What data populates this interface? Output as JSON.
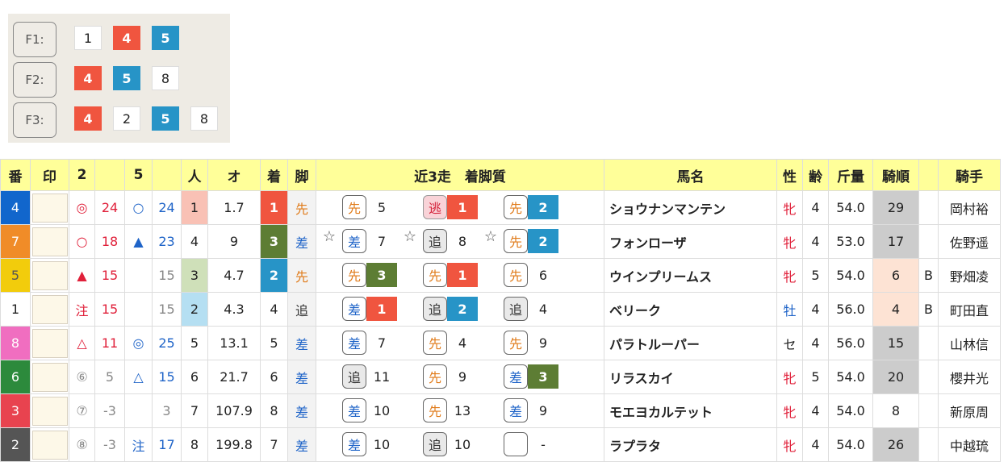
{
  "formation": [
    {
      "label": "F1:",
      "boxes": [
        {
          "v": "1",
          "c": "w"
        },
        {
          "v": "4",
          "c": "r"
        },
        {
          "v": "5",
          "c": "b"
        }
      ]
    },
    {
      "label": "F2:",
      "boxes": [
        {
          "v": "4",
          "c": "r"
        },
        {
          "v": "5",
          "c": "b"
        },
        {
          "v": "8",
          "c": "w"
        }
      ]
    },
    {
      "label": "F3:",
      "boxes": [
        {
          "v": "4",
          "c": "r"
        },
        {
          "v": "2",
          "c": "w"
        },
        {
          "v": "5",
          "c": "b"
        },
        {
          "v": "8",
          "c": "w"
        }
      ]
    }
  ],
  "headers": [
    "番",
    "印",
    "2",
    "",
    "5",
    "",
    "人",
    "オ",
    "着",
    "脚",
    "近3走　着脚質",
    "馬名",
    "性",
    "齢",
    "斤量",
    "騎順",
    "",
    "騎手"
  ],
  "rows": [
    {
      "waku": "4",
      "wakuColor": "#1166cc",
      "m2": "◎",
      "m2c": "red",
      "v2": "24",
      "v2c": "red",
      "m5": "○",
      "m5c": "blue",
      "v5": "24",
      "v5c": "blue",
      "ninki": "1",
      "nk": "1",
      "odds": "1.7",
      "chaku": "1",
      "ck": "1",
      "kyaku": "先",
      "kyc": "orange",
      "runs": [
        {
          "star": "",
          "style": "先",
          "sc": "sen",
          "pos": "5",
          "pc": ""
        },
        {
          "star": "",
          "style": "逃",
          "sc": "nige",
          "pos": "1",
          "pc": "c1"
        },
        {
          "star": "",
          "style": "先",
          "sc": "sen",
          "pos": "2",
          "pc": "c2"
        }
      ],
      "name": "ショウナンマンテン",
      "sex": "牝",
      "sexc": "f",
      "age": "4",
      "kin": "54.0",
      "kij": "29",
      "kijc": "g",
      "b": "",
      "jockey": "岡村裕"
    },
    {
      "waku": "7",
      "wakuColor": "#f08c28",
      "m2": "○",
      "m2c": "red",
      "v2": "18",
      "v2c": "red",
      "m5": "▲",
      "m5c": "blue",
      "v5": "23",
      "v5c": "blue",
      "ninki": "4",
      "nk": "",
      "odds": "9",
      "chaku": "3",
      "ck": "3",
      "kyaku": "差",
      "kyc": "blue",
      "runs": [
        {
          "star": "☆",
          "style": "差",
          "sc": "sa",
          "pos": "7",
          "pc": ""
        },
        {
          "star": "☆",
          "style": "追",
          "sc": "oi",
          "pos": "8",
          "pc": ""
        },
        {
          "star": "☆",
          "style": "先",
          "sc": "sen",
          "pos": "2",
          "pc": "c2"
        }
      ],
      "name": "フォンローザ",
      "sex": "牝",
      "sexc": "f",
      "age": "4",
      "kin": "53.0",
      "kij": "17",
      "kijc": "g",
      "b": "",
      "jockey": "佐野遥"
    },
    {
      "waku": "5",
      "wakuColor": "#f2cc0c",
      "m2": "▲",
      "m2c": "red",
      "v2": "15",
      "v2c": "red",
      "m5": "",
      "m5c": "",
      "v5": "15",
      "v5c": "gray",
      "ninki": "3",
      "nk": "3",
      "odds": "4.7",
      "chaku": "2",
      "ck": "2",
      "kyaku": "先",
      "kyc": "orange",
      "runs": [
        {
          "star": "",
          "style": "先",
          "sc": "sen",
          "pos": "3",
          "pc": "c3"
        },
        {
          "star": "",
          "style": "先",
          "sc": "sen",
          "pos": "1",
          "pc": "c1"
        },
        {
          "star": "",
          "style": "先",
          "sc": "sen",
          "pos": "6",
          "pc": ""
        }
      ],
      "name": "ウインプリームス",
      "sex": "牝",
      "sexc": "f",
      "age": "5",
      "kin": "54.0",
      "kij": "6",
      "kijc": "p",
      "b": "B",
      "jockey": "野畑凌"
    },
    {
      "waku": "1",
      "wakuColor": "#ffffff",
      "m2": "注",
      "m2c": "red",
      "v2": "15",
      "v2c": "red",
      "m5": "",
      "m5c": "",
      "v5": "15",
      "v5c": "gray",
      "ninki": "2",
      "nk": "2",
      "odds": "4.3",
      "chaku": "4",
      "ck": "",
      "kyaku": "追",
      "kyc": "mono",
      "runs": [
        {
          "star": "",
          "style": "差",
          "sc": "sa",
          "pos": "1",
          "pc": "c1"
        },
        {
          "star": "",
          "style": "追",
          "sc": "oi",
          "pos": "2",
          "pc": "c2"
        },
        {
          "star": "",
          "style": "追",
          "sc": "oi",
          "pos": "4",
          "pc": ""
        }
      ],
      "name": "ベリーク",
      "sex": "牡",
      "sexc": "m",
      "age": "4",
      "kin": "56.0",
      "kij": "4",
      "kijc": "p",
      "b": "B",
      "jockey": "町田直"
    },
    {
      "waku": "8",
      "wakuColor": "#f06ec0",
      "m2": "△",
      "m2c": "red",
      "v2": "11",
      "v2c": "red",
      "m5": "◎",
      "m5c": "blue",
      "v5": "25",
      "v5c": "blue",
      "ninki": "5",
      "nk": "",
      "odds": "13.1",
      "chaku": "5",
      "ck": "",
      "kyaku": "差",
      "kyc": "blue",
      "runs": [
        {
          "star": "",
          "style": "差",
          "sc": "sa",
          "pos": "7",
          "pc": ""
        },
        {
          "star": "",
          "style": "先",
          "sc": "sen",
          "pos": "4",
          "pc": ""
        },
        {
          "star": "",
          "style": "先",
          "sc": "sen",
          "pos": "9",
          "pc": ""
        }
      ],
      "name": "パラトルーパー",
      "sex": "セ",
      "sexc": "",
      "age": "4",
      "kin": "56.0",
      "kij": "15",
      "kijc": "g",
      "b": "",
      "jockey": "山林信"
    },
    {
      "waku": "6",
      "wakuColor": "#2c8a3c",
      "m2": "⑥",
      "m2c": "gray",
      "v2": "5",
      "v2c": "gray",
      "m5": "△",
      "m5c": "blue",
      "v5": "15",
      "v5c": "blue",
      "ninki": "6",
      "nk": "",
      "odds": "21.7",
      "chaku": "6",
      "ck": "",
      "kyaku": "差",
      "kyc": "blue",
      "runs": [
        {
          "star": "",
          "style": "追",
          "sc": "oi",
          "pos": "11",
          "pc": ""
        },
        {
          "star": "",
          "style": "先",
          "sc": "sen",
          "pos": "9",
          "pc": ""
        },
        {
          "star": "",
          "style": "差",
          "sc": "sa",
          "pos": "3",
          "pc": "c3"
        }
      ],
      "name": "リラスカイ",
      "sex": "牝",
      "sexc": "f",
      "age": "5",
      "kin": "54.0",
      "kij": "20",
      "kijc": "g",
      "b": "",
      "jockey": "櫻井光"
    },
    {
      "waku": "3",
      "wakuColor": "#e8434f",
      "m2": "⑦",
      "m2c": "gray",
      "v2": "-3",
      "v2c": "gray",
      "m5": "",
      "m5c": "",
      "v5": "3",
      "v5c": "gray",
      "ninki": "7",
      "nk": "",
      "odds": "107.9",
      "chaku": "8",
      "ck": "",
      "kyaku": "差",
      "kyc": "blue",
      "runs": [
        {
          "star": "",
          "style": "差",
          "sc": "sa",
          "pos": "10",
          "pc": ""
        },
        {
          "star": "",
          "style": "先",
          "sc": "sen",
          "pos": "13",
          "pc": ""
        },
        {
          "star": "",
          "style": "差",
          "sc": "sa",
          "pos": "9",
          "pc": ""
        }
      ],
      "name": "モエヨカルテット",
      "sex": "牝",
      "sexc": "f",
      "age": "4",
      "kin": "54.0",
      "kij": "8",
      "kijc": "",
      "b": "",
      "jockey": "新原周"
    },
    {
      "waku": "2",
      "wakuColor": "#555555",
      "m2": "⑧",
      "m2c": "gray",
      "v2": "-3",
      "v2c": "gray",
      "m5": "注",
      "m5c": "blue",
      "v5": "17",
      "v5c": "blue",
      "ninki": "8",
      "nk": "",
      "odds": "199.8",
      "chaku": "7",
      "ck": "",
      "kyaku": "差",
      "kyc": "blue",
      "runs": [
        {
          "star": "",
          "style": "差",
          "sc": "sa",
          "pos": "10",
          "pc": ""
        },
        {
          "star": "",
          "style": "追",
          "sc": "oi",
          "pos": "10",
          "pc": ""
        },
        {
          "star": "",
          "style": "",
          "sc": "empty",
          "pos": "-",
          "pc": ""
        }
      ],
      "name": "ラプラタ",
      "sex": "牝",
      "sexc": "f",
      "age": "4",
      "kin": "54.0",
      "kij": "26",
      "kijc": "g",
      "b": "",
      "jockey": "中越琉"
    }
  ]
}
